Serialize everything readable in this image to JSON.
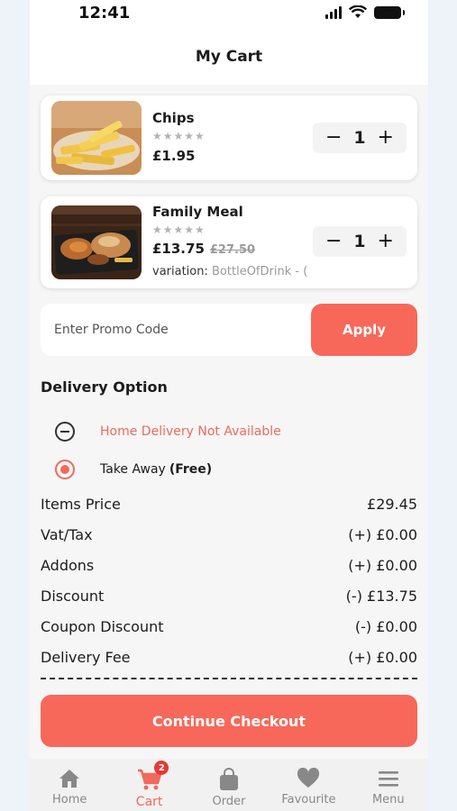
{
  "status_bar": {
    "time": "12:41"
  },
  "header": {
    "title": "My Cart"
  },
  "cart_items": [
    {
      "name": "Chips",
      "stars": "★★★★★",
      "price": "£1.95",
      "old_price": "",
      "quantity": "1",
      "image": "chips-image"
    },
    {
      "name": "Family Meal",
      "stars": "★★★★★",
      "price": "£13.75",
      "old_price": "£27.50",
      "quantity": "1",
      "variation_label": "variation:",
      "variation_value": "BottleOfDrink - (",
      "image": "family-meal-image"
    }
  ],
  "stepper": {
    "minus": "−",
    "plus": "+"
  },
  "promo": {
    "placeholder": "Enter Promo Code",
    "apply_label": "Apply"
  },
  "delivery": {
    "title": "Delivery Option",
    "home_delivery": "Home Delivery Not Available",
    "take_away": "Take Away",
    "take_away_note": "(Free)"
  },
  "summary": [
    {
      "label": "Items Price",
      "value": "£29.45"
    },
    {
      "label": "Vat/Tax",
      "value": "(+) £0.00"
    },
    {
      "label": "Addons",
      "value": "(+) £0.00"
    },
    {
      "label": "Discount",
      "value": "(-) £13.75"
    },
    {
      "label": "Coupon Discount",
      "value": "(-) £0.00"
    },
    {
      "label": "Delivery Fee",
      "value": "(+) £0.00"
    }
  ],
  "checkout": {
    "label": "Continue Checkout"
  },
  "tabs": [
    {
      "label": "Home",
      "icon": "home-icon"
    },
    {
      "label": "Cart",
      "icon": "cart-icon",
      "badge": "2",
      "active": true
    },
    {
      "label": "Order",
      "icon": "bag-icon"
    },
    {
      "label": "Favourite",
      "icon": "heart-icon"
    },
    {
      "label": "Menu",
      "icon": "menu-icon"
    }
  ],
  "colors": {
    "accent": "#f7685a",
    "text": "#1c1c1c",
    "muted": "#888888"
  }
}
